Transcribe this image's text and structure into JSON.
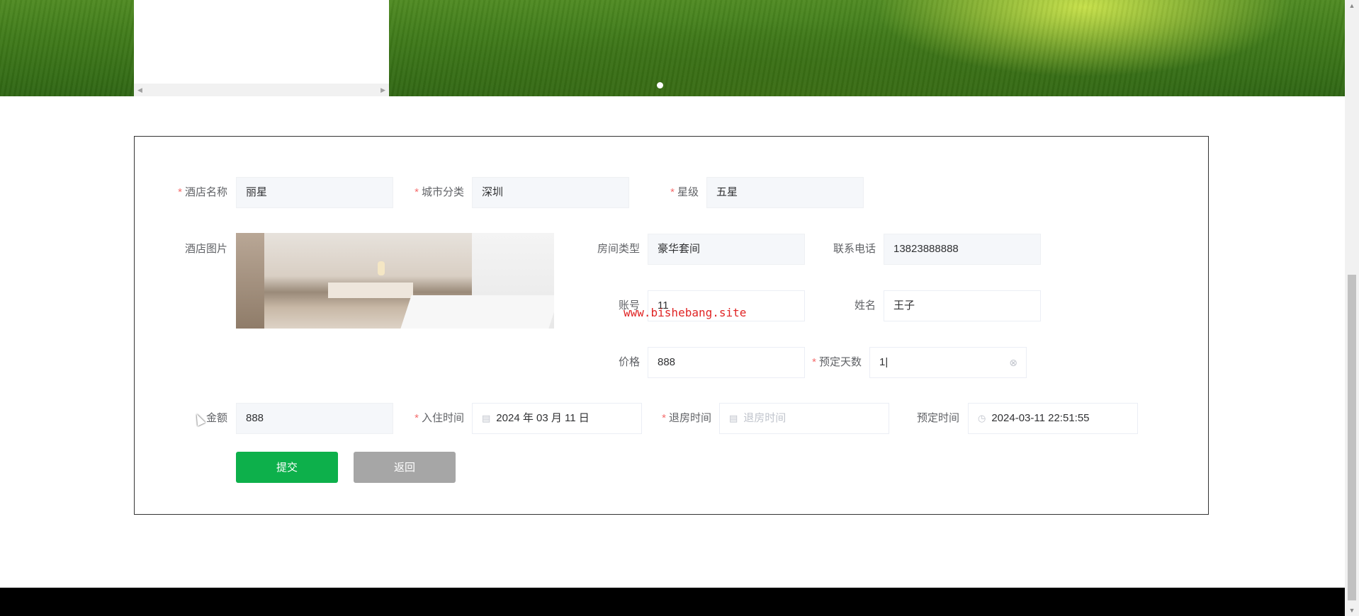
{
  "banner": {
    "side_scroll_left": "◀",
    "side_scroll_right": "▶"
  },
  "form": {
    "hotel_name": {
      "label": "酒店名称",
      "required": "*",
      "value": "丽星"
    },
    "city": {
      "label": "城市分类",
      "required": "*",
      "value": "深圳"
    },
    "stars": {
      "label": "星级",
      "required": "*",
      "value": "五星"
    },
    "hotel_image": {
      "label": "酒店图片"
    },
    "room_type": {
      "label": "房间类型",
      "value": "豪华套间"
    },
    "phone": {
      "label": "联系电话",
      "value": "13823888888"
    },
    "account": {
      "label": "账号",
      "value": "11"
    },
    "name": {
      "label": "姓名",
      "value": "王子"
    },
    "price": {
      "label": "价格",
      "value": "888"
    },
    "days": {
      "label": "预定天数",
      "required": "*",
      "value": "1|"
    },
    "amount": {
      "label": "金额",
      "value": "888"
    },
    "checkin": {
      "label": "入住时间",
      "required": "*",
      "value": "2024 年 03 月 11 日"
    },
    "checkout": {
      "label": "退房时间",
      "required": "*",
      "placeholder": "退房时间"
    },
    "booking_time": {
      "label": "预定时间",
      "value": "2024-03-11 22:51:55"
    },
    "submit_label": "提交",
    "back_label": "返回"
  },
  "watermark": "www.bishebang.site",
  "icons": {
    "calendar": "▤",
    "clock": "◷",
    "clear": "⊗"
  },
  "colors": {
    "submit": "#0db04b",
    "back": "#a6a6a6",
    "required": "#f56c6c"
  }
}
